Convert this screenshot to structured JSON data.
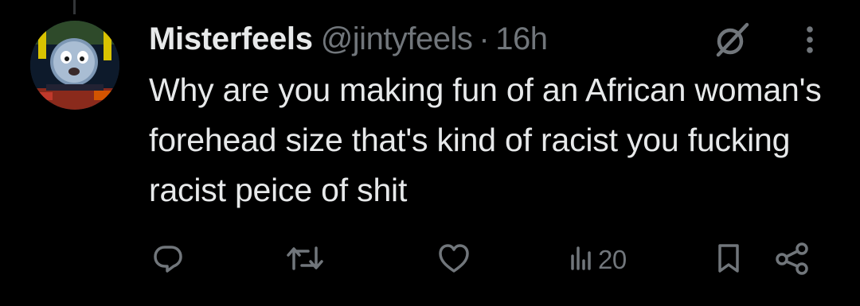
{
  "author": {
    "display_name": "Misterfeels",
    "handle": "@jintyfeels",
    "separator": "·",
    "time": "16h"
  },
  "tweet": {
    "text": "Why are you making fun of an African woman's forehead size that's kind of racist you fucking racist peice of shit"
  },
  "actions": {
    "views_count": "20"
  },
  "icons": {
    "grok": "grok-icon",
    "more": "more-icon",
    "reply": "reply-icon",
    "retweet": "retweet-icon",
    "like": "like-icon",
    "views": "views-icon",
    "bookmark": "bookmark-icon",
    "share": "share-icon"
  },
  "colors": {
    "background": "#000000",
    "primary_text": "#e7e9ea",
    "secondary_text": "#71767b"
  }
}
